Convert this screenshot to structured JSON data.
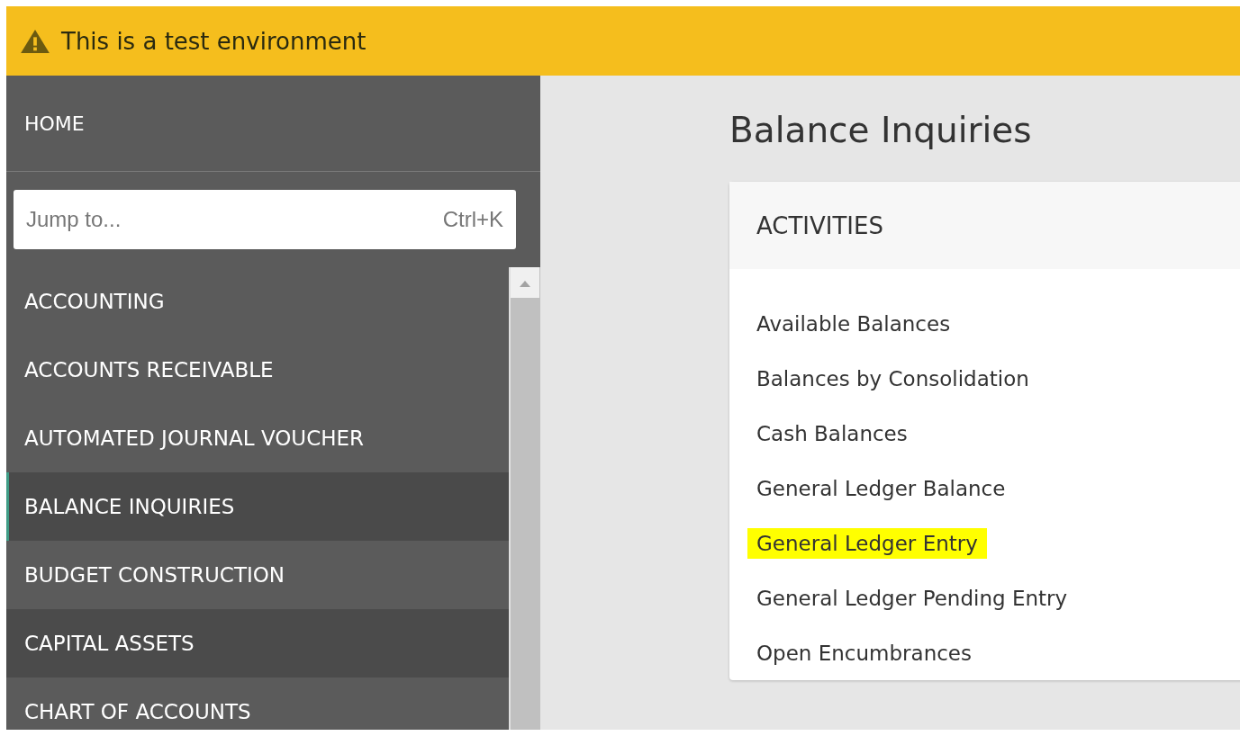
{
  "banner": {
    "text": "This is a test environment"
  },
  "sidebar": {
    "home": "HOME",
    "search": {
      "placeholder": "Jump to...",
      "shortcut": "Ctrl+K"
    },
    "items": [
      {
        "label": "ACCOUNTING",
        "selected": false,
        "hovered": false
      },
      {
        "label": "ACCOUNTS RECEIVABLE",
        "selected": false,
        "hovered": false
      },
      {
        "label": "AUTOMATED JOURNAL VOUCHER",
        "selected": false,
        "hovered": false
      },
      {
        "label": "BALANCE INQUIRIES",
        "selected": true,
        "hovered": false
      },
      {
        "label": "BUDGET CONSTRUCTION",
        "selected": false,
        "hovered": false
      },
      {
        "label": "CAPITAL ASSETS",
        "selected": false,
        "hovered": true
      },
      {
        "label": "CHART OF ACCOUNTS",
        "selected": false,
        "hovered": false
      }
    ]
  },
  "page": {
    "title": "Balance Inquiries",
    "card": {
      "heading": "ACTIVITIES",
      "links": [
        {
          "label": "Available Balances",
          "highlighted": false
        },
        {
          "label": "Balances by Consolidation",
          "highlighted": false
        },
        {
          "label": "Cash Balances",
          "highlighted": false
        },
        {
          "label": "General Ledger Balance",
          "highlighted": false
        },
        {
          "label": "General Ledger Entry",
          "highlighted": true
        },
        {
          "label": "General Ledger Pending Entry",
          "highlighted": false
        },
        {
          "label": "Open Encumbrances",
          "highlighted": false
        }
      ]
    }
  }
}
